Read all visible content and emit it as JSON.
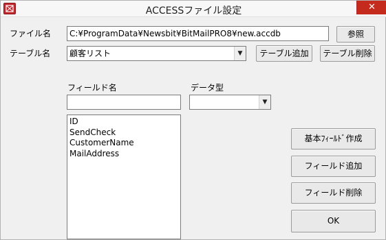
{
  "window": {
    "title": "ACCESSファイル設定",
    "close_glyph": "✕"
  },
  "file": {
    "label": "ファイル名",
    "value": "C:¥ProgramData¥Newsbit¥BitMailPRO8¥new.accdb",
    "browse_label": "参照"
  },
  "table": {
    "label": "テーブル名",
    "selected": "顧客リスト",
    "add_label": "テーブル追加",
    "delete_label": "テーブル削除"
  },
  "field_name": {
    "label": "フィールド名",
    "value": ""
  },
  "data_type": {
    "label": "データ型",
    "selected": ""
  },
  "fields_list": [
    "ID",
    "SendCheck",
    "CustomerName",
    "MailAddress"
  ],
  "buttons": {
    "basic_fields": "基本ﾌｨｰﾙﾄﾞ作成",
    "add_field": "フィールド追加",
    "delete_field": "フィールド削除",
    "ok": "OK"
  },
  "icons": {
    "app": "access-db-icon",
    "close": "close-icon",
    "dropdown": "chevron-down-icon"
  },
  "colors": {
    "close_button": "#c42b1c",
    "app_icon": "#c1272d"
  }
}
